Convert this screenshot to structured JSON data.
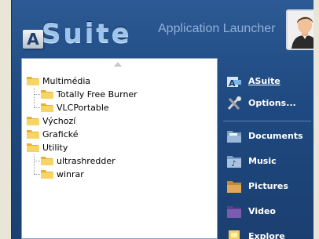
{
  "header": {
    "logo_letter": "A",
    "logo_word": "Suite",
    "subtitle": "Application Launcher"
  },
  "tree": {
    "items": [
      {
        "label": "Multimédia",
        "level": 0
      },
      {
        "label": "Totally Free Burner",
        "level": 1
      },
      {
        "label": "VLCPortable",
        "level": 1
      },
      {
        "label": "Výchozí",
        "level": 0
      },
      {
        "label": "Grafické",
        "level": 0
      },
      {
        "label": "Utility",
        "level": 0
      },
      {
        "label": "ultrashredder",
        "level": 1
      },
      {
        "label": "winrar",
        "level": 1
      }
    ]
  },
  "sidebar": {
    "items": [
      {
        "label": "ASuite",
        "icon": "asuite-icon"
      },
      {
        "label": "Options...",
        "icon": "tools-icon"
      },
      {
        "label": "Documents",
        "icon": "documents-folder-icon"
      },
      {
        "label": "Music",
        "icon": "music-folder-icon"
      },
      {
        "label": "Pictures",
        "icon": "pictures-folder-icon"
      },
      {
        "label": "Video",
        "icon": "video-folder-icon"
      },
      {
        "label": "Explore",
        "icon": "explore-icon"
      }
    ]
  },
  "colors": {
    "window_bg": "#1f4a82",
    "folder": "#f0c040",
    "sidebar_text": "#ffffff"
  }
}
